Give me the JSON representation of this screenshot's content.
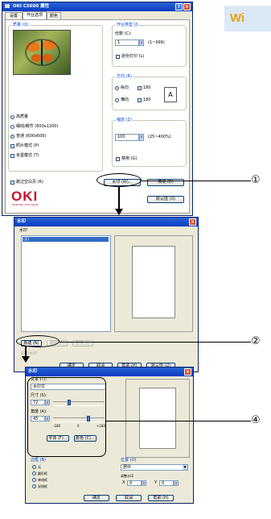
{
  "brand_badge": "Wi",
  "dialog1": {
    "title": "OKI C5600 属性",
    "tabs": [
      "设置",
      "作业选项",
      "颜色"
    ],
    "quality_label": "质量 (Q)",
    "quality_options": [
      "高质量",
      "细线/细节 (600x1200)",
      "普通 (600x600)"
    ],
    "photo_mode": "照片模式 (P)",
    "toner_saving": "省墨模式 (T)",
    "skip_blank": "跳过空白页 (K)",
    "job_type_label": "作业类型 (J)",
    "copies_label": "份数 (C):",
    "copies_value": "1",
    "copies_range": "(1~999)",
    "collate": "逐份打印 (L)",
    "orientation_label": "方向 (R)",
    "portrait": "纵向",
    "landscape": "横向",
    "rotate180a": "180",
    "rotate180b": "180",
    "scale_label": "缩放 (Z)",
    "scale_value": "100",
    "scale_range": "(25~400%)",
    "scale_disable": "禁用 (G)",
    "watermark_button": "水印 (W)...",
    "advanced_button": "高级 (D)",
    "default_button": "默认值 (U)",
    "logo_main": "OKI",
    "logo_sub": "PRINTING SOLUTIONS"
  },
  "dialog2": {
    "title": "水印",
    "list_label": "水印",
    "list_item": "(无)",
    "new_button": "新建 (N)",
    "edit_button": "编辑 (E)",
    "delete_button": "删除 (L)",
    "bottom_label": "打印水印",
    "buttons": [
      "确定",
      "取消",
      "帮助 (H)",
      "默认值 (U)"
    ]
  },
  "dialog3": {
    "title": "水印",
    "text_label": "文本 (T):",
    "text_value": "水印文",
    "size_label": "尺寸 (S):",
    "size_value": "72",
    "angle_label": "角度 (A):",
    "angle_value": "45",
    "angle_min": "-180",
    "angle_mid": "0",
    "angle_max": "+180",
    "font_button": "字体 (F)...",
    "color_button": "颜色 (C)...",
    "position_label": "位置 (O)",
    "position_value": "居中",
    "adjust_label": "调整水印",
    "x_label": "X",
    "x_value": "0",
    "y_label": "Y",
    "y_value": "0",
    "border_label": "边框 (B)",
    "border_options": [
      "无",
      "圆形框",
      "单线框",
      "双线框"
    ],
    "buttons": [
      "确定",
      "取消",
      "帮助 (H)"
    ]
  },
  "callouts": [
    "①",
    "②",
    "④"
  ]
}
